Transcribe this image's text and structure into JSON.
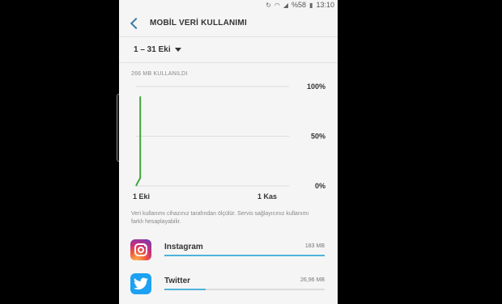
{
  "status": {
    "battery": "%58",
    "time": "13:10",
    "icons": [
      "sync-icon",
      "wifi-icon",
      "signal-icon",
      "battery-icon"
    ]
  },
  "header": {
    "title": "MOBİL VERİ KULLANIMI",
    "back_icon": "back-arrow-icon"
  },
  "range": {
    "label": "1 – 31 Eki",
    "icon": "dropdown-caret-icon"
  },
  "usage_label": "266 MB KULLANILDI",
  "chart_data": {
    "type": "line",
    "x_ticks": [
      "1 Eki",
      "1 Kas"
    ],
    "y_ticks": [
      "100%",
      "50%",
      "0%"
    ],
    "ylim": [
      0,
      100
    ],
    "series": [
      {
        "x": [
          0,
          0.01,
          0.03,
          0.03
        ],
        "y": [
          0,
          3,
          8,
          90
        ]
      }
    ],
    "line_color": "#3ea53a",
    "grid": true
  },
  "note": "Veri kullanımı cihazınız tarafından ölçülür. Servis sağlayıcınız kullanımı farklı hesaplayabilir.",
  "apps": [
    {
      "name": "Instagram",
      "size": "183 MB",
      "usage_fraction": 1.0,
      "icon": "instagram-icon"
    },
    {
      "name": "Twitter",
      "size": "26,96 MB",
      "usage_fraction": 0.26,
      "icon": "twitter-icon"
    }
  ],
  "colors": {
    "accent": "#4fb3d9",
    "chart_line": "#3ea53a",
    "back_arrow": "#3a7ca5"
  }
}
